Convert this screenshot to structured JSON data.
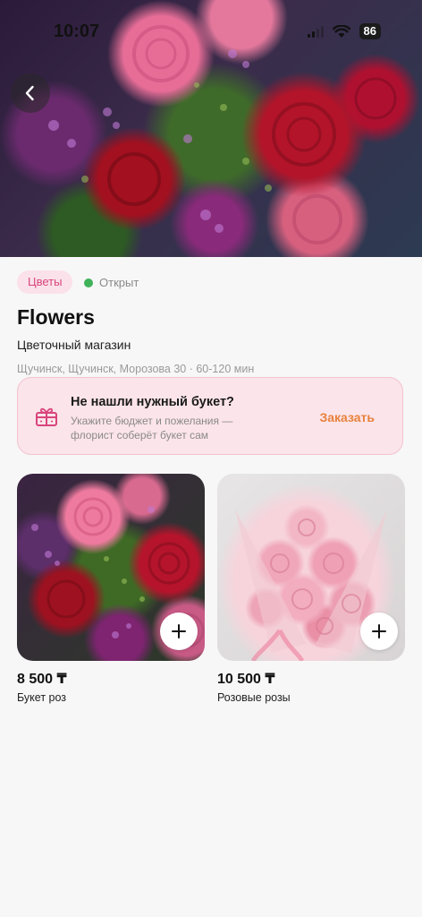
{
  "status_bar": {
    "time": "10:07",
    "battery": "86"
  },
  "header": {
    "back_icon": "chevron-left-icon"
  },
  "shop": {
    "category_chip": "Цветы",
    "open_status": "Открыт",
    "open_status_color": "#3fb25a",
    "name": "Flowers",
    "type": "Цветочный магазин",
    "address": "Щучинск, Щучинск, Морозова 30 · 60-120 мин"
  },
  "promo": {
    "icon": "gift-icon",
    "title": "Не нашли нужный букет?",
    "description": "Укажите бюджет и пожелания — флорист соберёт букет сам",
    "action_label": "Заказать",
    "accent_color": "#e8823d",
    "background_color": "#fbe4ea"
  },
  "products": [
    {
      "price": "8 500 ₸",
      "name": "Букет роз",
      "add_icon": "plus-icon"
    },
    {
      "price": "10 500 ₸",
      "name": "Розовые розы",
      "add_icon": "plus-icon"
    }
  ],
  "colors": {
    "chip_text": "#d8457c",
    "chip_background": "#fbe1ea",
    "page_background": "#f7f7f7"
  }
}
